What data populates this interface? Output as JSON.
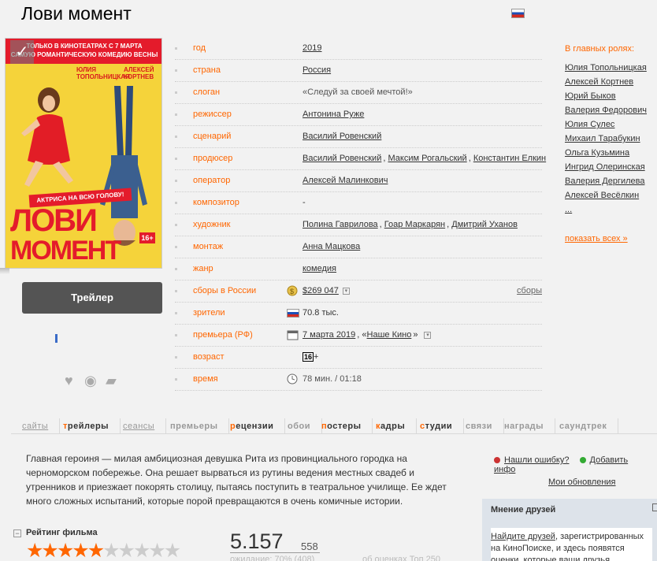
{
  "title": "Лови момент",
  "poster": {
    "banner": "ТОЛЬКО В КИНОТЕАТРАХ С 7 МАРТА\nСАМУЮ РОМАНТИЧЕСКУЮ КОМЕДИЮ ВЕСНЫ",
    "actor1": "ЮЛИЯ\nТОПОЛЬНИЦКАЯ",
    "actor2": "АЛЕКСЕЙ\nКОРТНЕВ",
    "tagline": "АКТРИСА НА ВСЮ ГОЛОВУ!",
    "title1": "ЛОВИ",
    "title2": "МОМЕНТ",
    "age": "16+"
  },
  "trailer_label": "Трейлер",
  "info": {
    "year_label": "год",
    "year": "2019",
    "country_label": "страна",
    "country": "Россия",
    "slogan_label": "слоган",
    "slogan": "«Следуй за своей мечтой!»",
    "director_label": "режиссер",
    "director": "Антонина Руже",
    "writer_label": "сценарий",
    "writer": "Василий Ровенский",
    "producer_label": "продюсер",
    "producers": [
      "Василий Ровенский",
      "Максим Рогальский",
      "Константин Елкин"
    ],
    "operator_label": "оператор",
    "operator": "Алексей Малинкович",
    "composer_label": "композитор",
    "composer": "-",
    "artist_label": "художник",
    "artists": [
      "Полина Гаврилова",
      "Гоар Маркарян",
      "Дмитрий Уханов"
    ],
    "editing_label": "монтаж",
    "editing": "Анна Мацкова",
    "genre_label": "жанр",
    "genre": "комедия",
    "boxoffice_label": "сборы в России",
    "boxoffice": "$269 047",
    "boxoffice_link": "сборы",
    "viewers_label": "зрители",
    "viewers": "70.8 тыс.",
    "premiere_label": "премьера (РФ)",
    "premiere": "7 марта 2019",
    "premiere_distributor": "Наше Кино",
    "age_label": "возраст",
    "age": "16",
    "time_label": "время",
    "time": "78 мин. / 01:18"
  },
  "cast": {
    "heading": "В главных ролях:",
    "actors": [
      "Юлия Топольницкая",
      "Алексей Кортнев",
      "Юрий Быков",
      "Валерия Федорович",
      "Юлия Сулес",
      "Михаил Тарабукин",
      "Ольга Кузьмина",
      "Ингрид Олеринская",
      "Валерия Дергилева",
      "Алексей Весёлкин",
      "..."
    ],
    "show_all": "показать всех »"
  },
  "tabs": [
    "сайты",
    "трейлеры",
    "сеансы",
    "премьеры",
    "рецензии",
    "обои",
    "постеры",
    "кадры",
    "студии",
    "связи",
    "награды",
    "саундтрек"
  ],
  "description": "Главная героиня — милая амбициозная девушка Рита из провинциального городка на черноморском побережье. Она решает вырваться из рутины ведения местных свадеб и утренников и приезжает покорять столицу, пытаясь поступить в театральное училище. Ее ждет много сложных испытаний, которые порой превращаются в очень комичные истории.",
  "side": {
    "error_link": "Нашли ошибку?",
    "add_link": "Добавить инфо",
    "updates": "Мои обновления",
    "friends_head": "Мнение друзей",
    "friends_link": "Найдите друзей",
    "friends_text": ", зарегистрированных на КиноПоиске, и здесь появятся оценки, которые ваши друзья"
  },
  "rating": {
    "heading": "Рейтинг фильма",
    "score": "5.157",
    "votes": "558",
    "expect": "ожидание: 70% (408)",
    "top": "об оценках Топ 250",
    "stars": 5
  },
  "colors": {
    "accent": "#ff6600",
    "button": "#545454"
  }
}
